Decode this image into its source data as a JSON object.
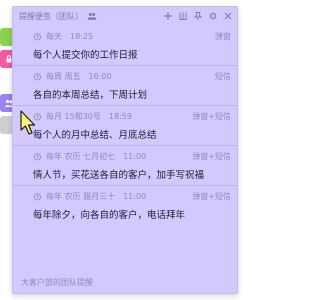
{
  "window": {
    "title": "提醒便签（团队）",
    "icons": [
      "group-icon",
      "plus-icon",
      "grid-icon",
      "pin-icon",
      "gear-icon",
      "close-icon"
    ]
  },
  "reminders": [
    {
      "date": "每天",
      "time": "18:25",
      "kind": "弹窗",
      "text": "每个人提交你的工作日报"
    },
    {
      "date": "每周 周五",
      "time": "16:00",
      "kind": "短信",
      "text": "各自的本周总结，下周计划"
    },
    {
      "date": "每月 15和30号",
      "time": "18:59",
      "kind": "弹窗+短信",
      "text": "每个人的月中总结、月底总结"
    },
    {
      "date": "每年 农历 七月初七",
      "time": "11:00",
      "kind": "弹窗+短信",
      "text": "情人节，买花送各自的客户，加手写祝福"
    },
    {
      "date": "每年 农历 腊月三十",
      "time": "11:00",
      "kind": "弹窗+短信",
      "text": "每年除夕，向各自的客户，电话拜年"
    }
  ],
  "footer": "大客户部的团队提醒",
  "tabs": [
    {
      "color": "#8bd24e",
      "icon": ""
    },
    {
      "color": "#f25aa6",
      "icon": "lock-icon"
    },
    {
      "color": "#ffffff",
      "icon": ""
    },
    {
      "color": "#9a82f0",
      "icon": "people-icon"
    },
    {
      "color": "#cfcfcf",
      "icon": ""
    }
  ],
  "colors": {
    "window_bg": "#d2caff",
    "accent": "#9a82f0"
  }
}
